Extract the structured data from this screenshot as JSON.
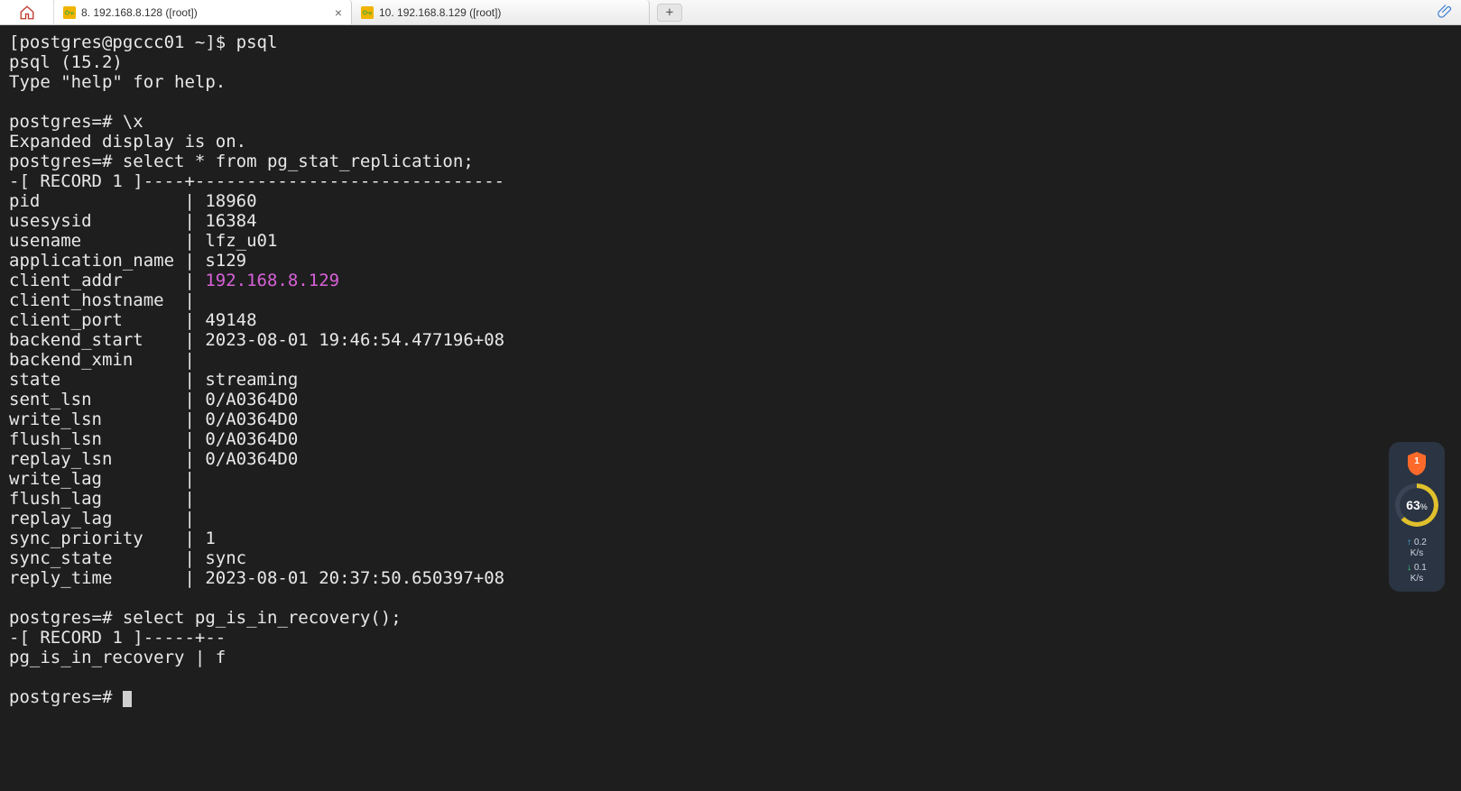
{
  "tabs": [
    {
      "label": "8. 192.168.8.128 ([root])",
      "active": true
    },
    {
      "label": "10. 192.168.8.129 ([root])",
      "active": false
    }
  ],
  "terminal": {
    "prompt1": "[postgres@pgccc01 ~]$ psql",
    "version": "psql (15.2)",
    "help": "Type \"help\" for help.",
    "cmd_x": "postgres=# \\x",
    "expanded": "Expanded display is on.",
    "cmd_select": "postgres=# select * from pg_stat_replication;",
    "record_hdr": "-[ RECORD 1 ]----+------------------------------",
    "fields": [
      {
        "k": "pid             ",
        "v": " 18960"
      },
      {
        "k": "usesysid        ",
        "v": " 16384"
      },
      {
        "k": "usename         ",
        "v": " lfz_u01"
      },
      {
        "k": "application_name",
        "v": " s129"
      },
      {
        "k": "client_addr     ",
        "v": " 192.168.8.129",
        "ip": true
      },
      {
        "k": "client_hostname ",
        "v": " "
      },
      {
        "k": "client_port     ",
        "v": " 49148"
      },
      {
        "k": "backend_start   ",
        "v": " 2023-08-01 19:46:54.477196+08"
      },
      {
        "k": "backend_xmin    ",
        "v": " "
      },
      {
        "k": "state           ",
        "v": " streaming"
      },
      {
        "k": "sent_lsn        ",
        "v": " 0/A0364D0"
      },
      {
        "k": "write_lsn       ",
        "v": " 0/A0364D0"
      },
      {
        "k": "flush_lsn       ",
        "v": " 0/A0364D0"
      },
      {
        "k": "replay_lsn      ",
        "v": " 0/A0364D0"
      },
      {
        "k": "write_lag       ",
        "v": " "
      },
      {
        "k": "flush_lag       ",
        "v": " "
      },
      {
        "k": "replay_lag      ",
        "v": " "
      },
      {
        "k": "sync_priority   ",
        "v": " 1"
      },
      {
        "k": "sync_state      ",
        "v": " sync"
      },
      {
        "k": "reply_time      ",
        "v": " 2023-08-01 20:37:50.650397+08"
      }
    ],
    "cmd_recovery": "postgres=# select pg_is_in_recovery();",
    "record_hdr2": "-[ RECORD 1 ]-----+--",
    "recovery_row_k": "pg_is_in_recovery",
    "recovery_row_v": " f",
    "prompt_end": "postgres=# "
  },
  "widget": {
    "shield_badge": "1",
    "percent": "63",
    "percent_suffix": "%",
    "up_rate": "0.2",
    "up_unit": "K/s",
    "down_rate": "0.1",
    "down_unit": "K/s"
  }
}
